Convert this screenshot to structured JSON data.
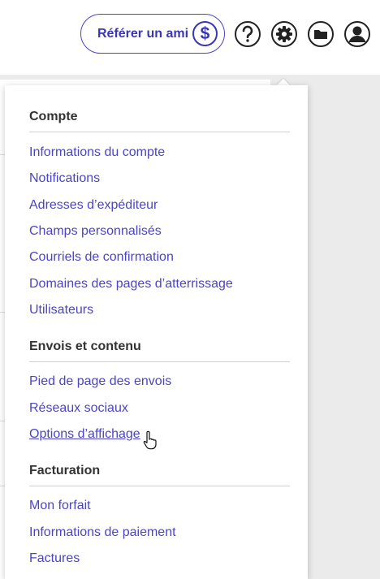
{
  "header": {
    "refer_label": "Référer un ami",
    "dollar_symbol": "$",
    "icons": [
      "help-icon",
      "settings-gear-icon",
      "folder-icon",
      "user-profile-icon"
    ]
  },
  "menu": {
    "sections": [
      {
        "title": "Compte",
        "items": [
          "Informations du compte",
          "Notifications",
          "Adresses d’expéditeur",
          "Champs personnalisés",
          "Courriels de confirmation",
          "Domaines des pages d’atterrissage",
          "Utilisateurs"
        ]
      },
      {
        "title": "Envois et contenu",
        "items": [
          "Pied de page des envois",
          "Réseaux sociaux",
          "Options d’affichage"
        ]
      },
      {
        "title": "Facturation",
        "items": [
          "Mon forfait",
          "Informations de paiement",
          "Factures"
        ]
      }
    ],
    "hovered_item": "Options d’affichage"
  },
  "colors": {
    "accent": "#4b45c5",
    "text": "#333333",
    "background": "#ebebeb"
  }
}
